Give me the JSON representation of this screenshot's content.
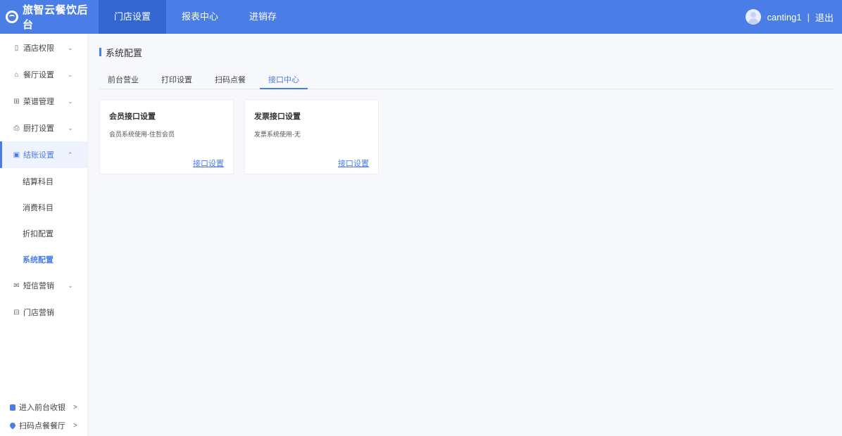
{
  "brand": {
    "name": "旅智云餐饮后台"
  },
  "topnav": [
    {
      "label": "门店设置",
      "active": true
    },
    {
      "label": "报表中心",
      "active": false
    },
    {
      "label": "进销存",
      "active": false
    }
  ],
  "user": {
    "name": "canting1",
    "separator": "|",
    "logout": "退出"
  },
  "sidebar": {
    "items": [
      {
        "label": "酒店权限",
        "icon": "building-icon",
        "chevron": "⌄"
      },
      {
        "label": "餐厅设置",
        "icon": "home-icon",
        "chevron": "⌄"
      },
      {
        "label": "菜谱管理",
        "icon": "grid-icon",
        "chevron": "⌄"
      },
      {
        "label": "厨打设置",
        "icon": "printer-icon",
        "chevron": "⌄"
      },
      {
        "label": "结账设置",
        "icon": "bill-icon",
        "chevron": "⌃",
        "active": true
      }
    ],
    "subitems": [
      {
        "label": "结算科目"
      },
      {
        "label": "消费科目"
      },
      {
        "label": "折扣配置"
      },
      {
        "label": "系统配置",
        "current": true
      }
    ],
    "items2": [
      {
        "label": "短信营销",
        "icon": "mail-icon",
        "chevron": "⌄"
      },
      {
        "label": "门店营销",
        "icon": "store-icon"
      }
    ],
    "bottom": [
      {
        "label": "进入前台收银",
        "arrow": ">"
      },
      {
        "label": "扫码点餐餐厅",
        "arrow": ">"
      }
    ]
  },
  "main": {
    "title": "系统配置",
    "tabs": [
      {
        "label": "前台营业"
      },
      {
        "label": "打印设置"
      },
      {
        "label": "扫码点餐"
      },
      {
        "label": "接口中心",
        "active": true
      }
    ],
    "cards": [
      {
        "title": "会员接口设置",
        "desc": "会员系统使用-住哲会员",
        "link": "接口设置"
      },
      {
        "title": "发票接口设置",
        "desc": "发票系统使用-无",
        "link": "接口设置"
      }
    ]
  },
  "colors": {
    "primary": "#4a7ee6",
    "primary_dark": "#3466d0",
    "background": "#f7f8fc"
  }
}
